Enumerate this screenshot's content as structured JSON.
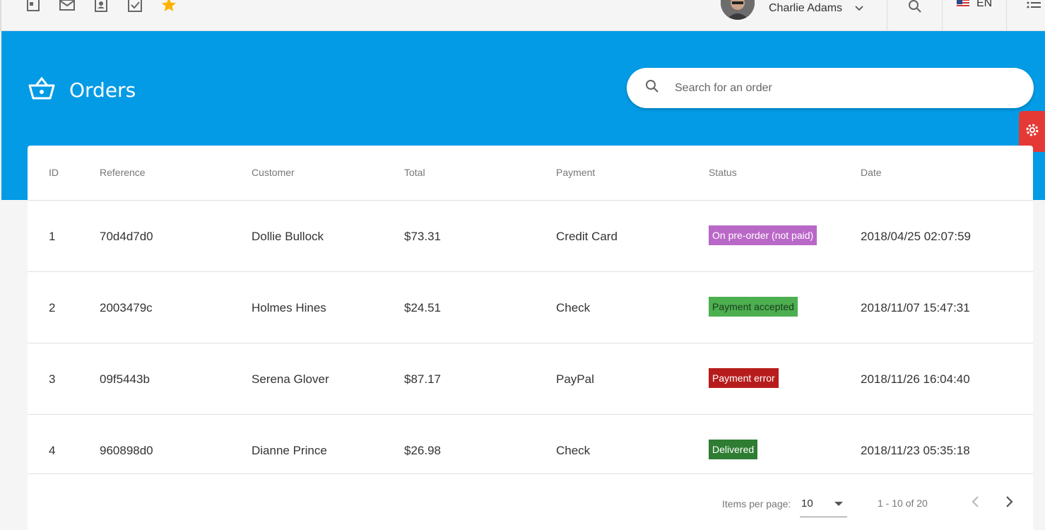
{
  "toolbar": {
    "user_name": "Charlie Adams",
    "language": "EN",
    "icons": [
      "calendar-icon",
      "mail-icon",
      "contacts-icon",
      "todo-icon",
      "star-icon",
      "search-icon",
      "menu-icon"
    ]
  },
  "header": {
    "title": "Orders",
    "search_placeholder": "Search for an order"
  },
  "table": {
    "columns": [
      "ID",
      "Reference",
      "Customer",
      "Total",
      "Payment",
      "Status",
      "Date"
    ],
    "rows": [
      {
        "id": "1",
        "reference": "70d4d7d0",
        "customer": "Dollie Bullock",
        "total": "$73.31",
        "payment": "Credit Card",
        "status": "On pre-order (not paid)",
        "status_color": "#ba68c8",
        "status_text_color": "#ffffff",
        "date": "2018/04/25 02:07:59"
      },
      {
        "id": "2",
        "reference": "2003479c",
        "customer": "Holmes Hines",
        "total": "$24.51",
        "payment": "Check",
        "status": "Payment accepted",
        "status_color": "#4caf50",
        "status_text_color": "#1b3a1b",
        "date": "2018/11/07 15:47:31"
      },
      {
        "id": "3",
        "reference": "09f5443b",
        "customer": "Serena Glover",
        "total": "$87.17",
        "payment": "PayPal",
        "status": "Payment error",
        "status_color": "#b71c1c",
        "status_text_color": "#ffffff",
        "date": "2018/11/26 16:04:40"
      },
      {
        "id": "4",
        "reference": "960898d0",
        "customer": "Dianne Prince",
        "total": "$26.98",
        "payment": "Check",
        "status": "Delivered",
        "status_color": "#2e7d32",
        "status_text_color": "#ffffff",
        "date": "2018/11/23 05:35:18"
      }
    ]
  },
  "pager": {
    "items_per_page_label": "Items per page:",
    "items_per_page_value": "10",
    "range_label": "1 - 10 of 20"
  },
  "colors": {
    "brand_blue": "#039be5",
    "settings_red": "#e53935",
    "star": "#ffb300"
  }
}
